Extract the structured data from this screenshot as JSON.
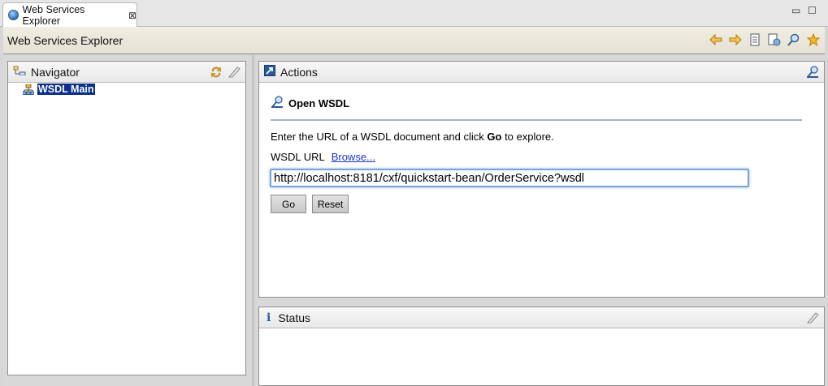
{
  "tab": {
    "label": "Web Services Explorer",
    "close": "⊠"
  },
  "window_controls": {
    "minimize": "▭",
    "maximize": "☐"
  },
  "app": {
    "title": "Web Services Explorer"
  },
  "toolbar": {
    "icons": [
      "back-icon",
      "forward-icon",
      "history-icon",
      "page-icon",
      "search-icon",
      "favorites-icon"
    ]
  },
  "navigator": {
    "title": "Navigator",
    "tree": [
      {
        "label": "WSDL Main",
        "selected": true
      }
    ]
  },
  "actions": {
    "title": "Actions",
    "section_title": "Open WSDL",
    "description_pre": "Enter the URL of a WSDL document and click ",
    "description_bold": "Go",
    "description_post": " to explore.",
    "url_label": "WSDL URL",
    "browse_label": "Browse...",
    "url_value": "http://localhost:8181/cxf/quickstart-bean/OrderService?wsdl",
    "go_label": "Go",
    "reset_label": "Reset"
  },
  "status": {
    "title": "Status",
    "icon_text": "i"
  },
  "colors": {
    "selection": "#0b2f8a",
    "link": "#1a35c7",
    "toolbar_icon": "#c07d00"
  }
}
